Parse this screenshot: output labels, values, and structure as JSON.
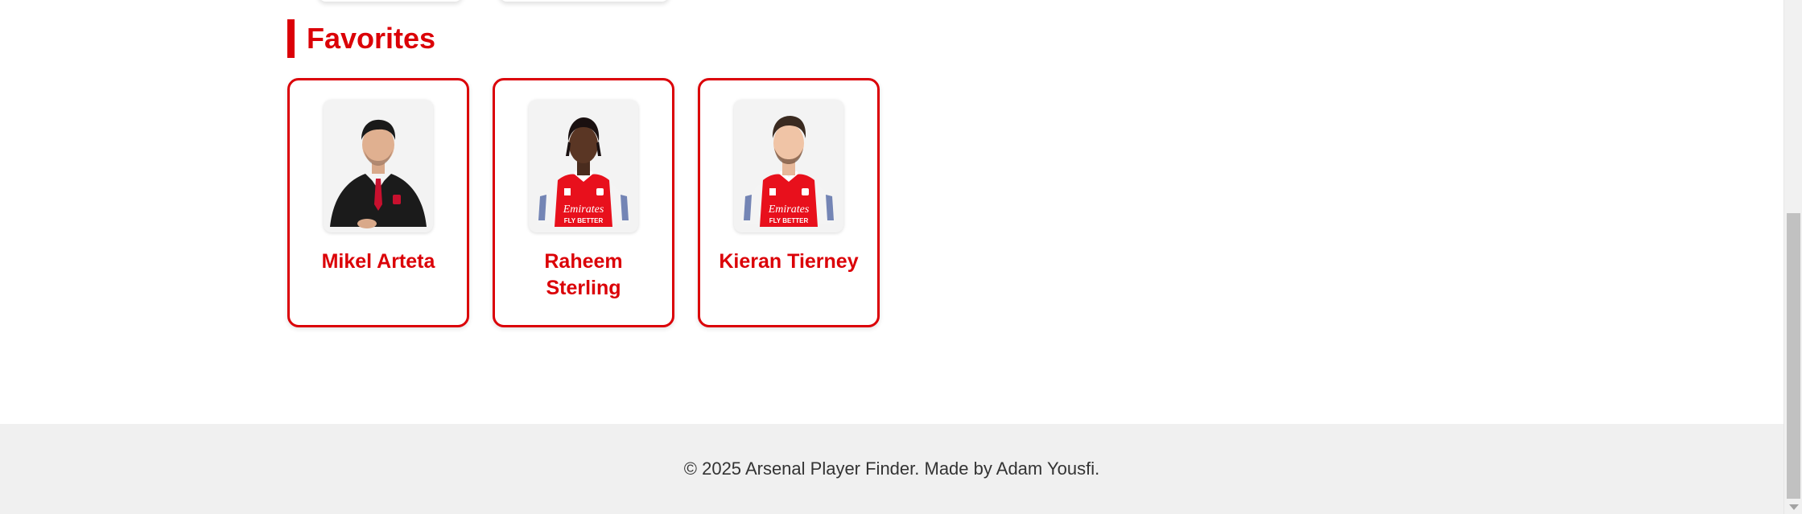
{
  "favorites": {
    "heading": "Favorites",
    "players": [
      {
        "name": "Mikel Arteta",
        "photo": "manager-suit-photo"
      },
      {
        "name": "Raheem Sterling",
        "photo": "player-kit-photo"
      },
      {
        "name": "Kieran Tierney",
        "photo": "player-kit-photo"
      }
    ]
  },
  "footer": {
    "text": "© 2025 Arsenal Player Finder. Made by Adam Yousfi."
  },
  "colors": {
    "accent": "#db0007",
    "footer_bg": "#f0f0f0",
    "footer_text": "#333333"
  }
}
